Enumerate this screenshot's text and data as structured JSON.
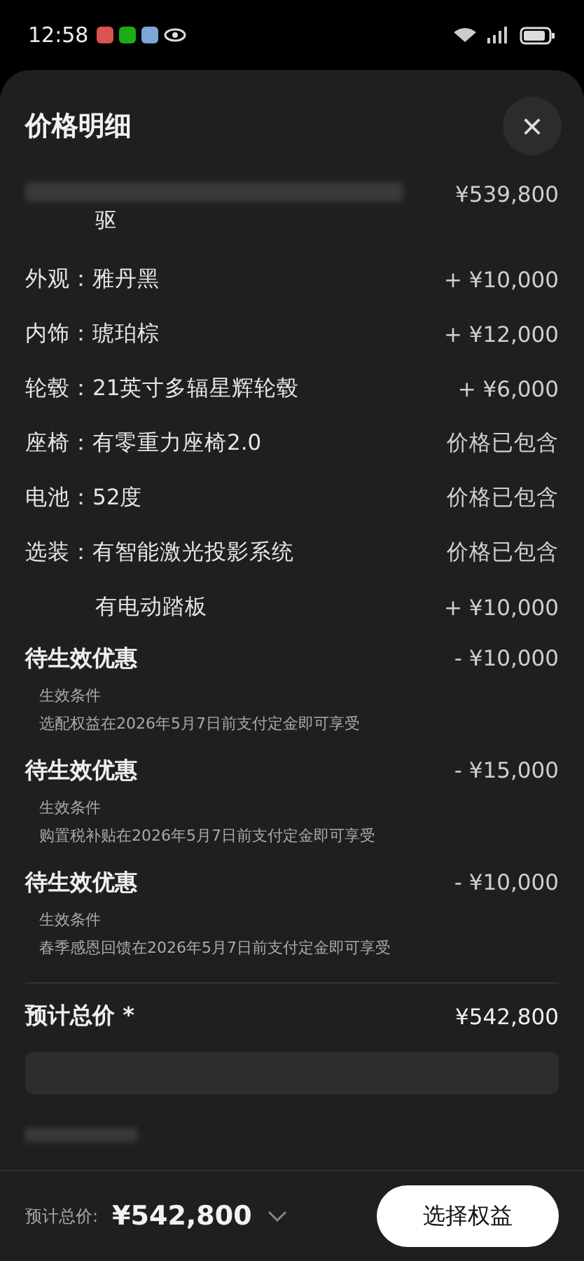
{
  "status_bar": {
    "time": "12:58"
  },
  "sheet": {
    "title": "价格明细",
    "close_label": "×"
  },
  "base": {
    "label": "驱",
    "price": "¥539,800"
  },
  "items": [
    {
      "label": "外观：",
      "value": "雅丹黑",
      "price": "+ ¥10,000"
    },
    {
      "label": "内饰：",
      "value": "琥珀棕",
      "price": "+ ¥12,000"
    },
    {
      "label": "轮毂：",
      "value": "21英寸多辐星辉轮毂",
      "price": "+ ¥6,000"
    },
    {
      "label": "座椅：",
      "value": "有零重力座椅2.0",
      "price": "价格已包含"
    },
    {
      "label": "电池：",
      "value": "52度",
      "price": "价格已包含"
    },
    {
      "label": "选装：",
      "value": "有智能激光投影系统",
      "price": "价格已包含"
    },
    {
      "value": "有电动踏板",
      "price": "+ ¥10,000"
    }
  ],
  "discounts": [
    {
      "title": "待生效优惠",
      "amount": "- ¥10,000",
      "condition_label": "生效条件",
      "condition": "选配权益在2026年5月7日前支付定金即可享受"
    },
    {
      "title": "待生效优惠",
      "amount": "- ¥15,000",
      "condition_label": "生效条件",
      "condition": "购置税补贴在2026年5月7日前支付定金即可享受"
    },
    {
      "title": "待生效优惠",
      "amount": "- ¥10,000",
      "condition_label": "生效条件",
      "condition": "春季感恩回馈在2026年5月7日前支付定金即可享受"
    }
  ],
  "total": {
    "label": "预计总价 *",
    "price": "¥542,800"
  },
  "footer": {
    "label": "预计总价:",
    "price": "¥542,800",
    "button": "选择权益"
  }
}
